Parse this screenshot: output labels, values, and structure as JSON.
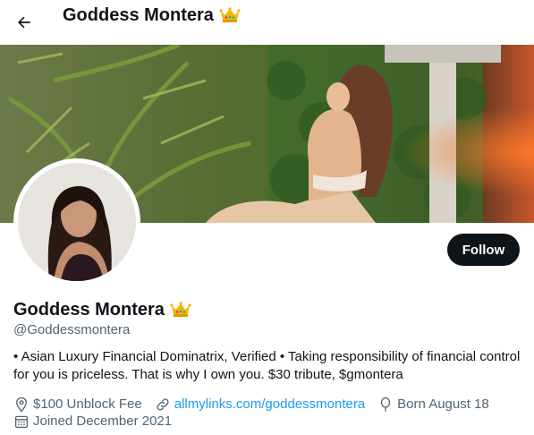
{
  "header": {
    "title": "Goddess Montera",
    "title_emoji": "crown-icon",
    "back_icon": "arrow-left-icon"
  },
  "profile": {
    "display_name": "Goddess Montera",
    "handle": "@Goddessmontera",
    "bio": "• Asian Luxury Financial Dominatrix, Verified • Taking responsibility of financial control for you is priceless. That is why I own you. $30 tribute, $gmontera",
    "follow_label": "Follow",
    "location": "$100 Unblock Fee",
    "website": "allmylinks.com/goddessmontera",
    "birthday": "Born August 18",
    "joined": "Joined December 2021"
  },
  "icons": {
    "location": "location-pin-icon",
    "website": "link-icon",
    "birthday": "balloon-icon",
    "joined": "calendar-icon"
  },
  "colors": {
    "primary_text": "#0f1419",
    "secondary_text": "#536471",
    "link": "#1d9bf0",
    "follow_bg": "#0f1419"
  }
}
